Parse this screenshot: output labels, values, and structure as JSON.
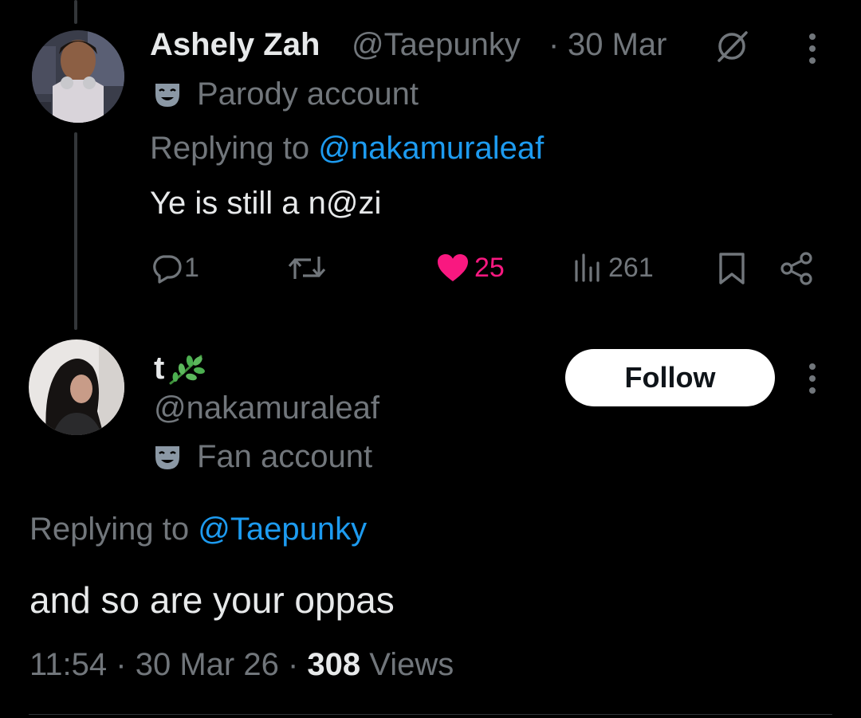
{
  "reply_tweet": {
    "author_name": "Ashely Zah",
    "author_handle": "@Taepunky",
    "separator": "·",
    "date": "30 Mar",
    "account_label": "Parody account",
    "replying_to_prefix": "Replying to",
    "replying_to_handle": "@nakamuraleaf",
    "text": "Ye is still a n@zi",
    "replies_count": "1",
    "likes_count": "25",
    "views_count": "261",
    "like_color": "#f91880"
  },
  "main_tweet": {
    "author_name": "t",
    "author_handle": "@nakamuraleaf",
    "account_label": "Fan account",
    "follow_label": "Follow",
    "replying_to_prefix": "Replying to",
    "replying_to_handle": "@Taepunky",
    "text": "and so are your oppas",
    "time": "11:54",
    "separator": "·",
    "date": "30 Mar 26",
    "views_count": "308",
    "views_label": "Views"
  },
  "icons": {
    "grok": "slashed-circle-icon",
    "more": "more-vertical-icon",
    "label": "theater-mask-icon",
    "reply": "reply-icon",
    "retweet": "retweet-icon",
    "like": "heart-icon",
    "views": "views-chart-icon",
    "bookmark": "bookmark-icon",
    "share": "share-icon",
    "name_emoji": "herb-emoji"
  },
  "colors": {
    "background": "#000000",
    "text_primary": "#e7e9ea",
    "text_secondary": "#71767b",
    "link": "#1d9bf0",
    "like": "#f91880"
  }
}
